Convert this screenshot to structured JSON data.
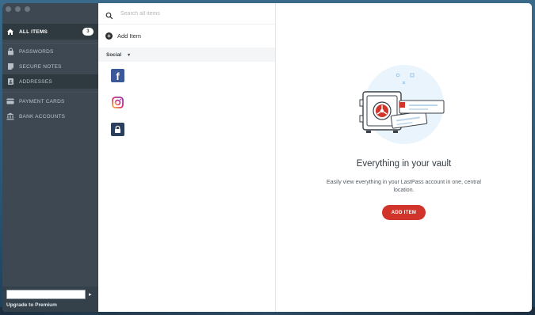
{
  "sidebar": {
    "all_items": {
      "label": "ALL ITEMS",
      "count": "3"
    },
    "items": [
      {
        "label": "PASSWORDS"
      },
      {
        "label": "SECURE NOTES"
      },
      {
        "label": "ADDRESSES"
      },
      {
        "label": "PAYMENT CARDS"
      },
      {
        "label": "BANK ACCOUNTS"
      }
    ],
    "upgrade_label": "Upgrade to Premium"
  },
  "list": {
    "search_placeholder": "Search all items",
    "add_item_label": "Add Item",
    "folder_label": "Social"
  },
  "main": {
    "title": "Everything in your vault",
    "description": "Easily view everything in your LastPass account in one, central location.",
    "button_label": "ADD ITEM"
  },
  "colors": {
    "accent": "#d1342a",
    "sidebar_bg": "#3d4852"
  }
}
